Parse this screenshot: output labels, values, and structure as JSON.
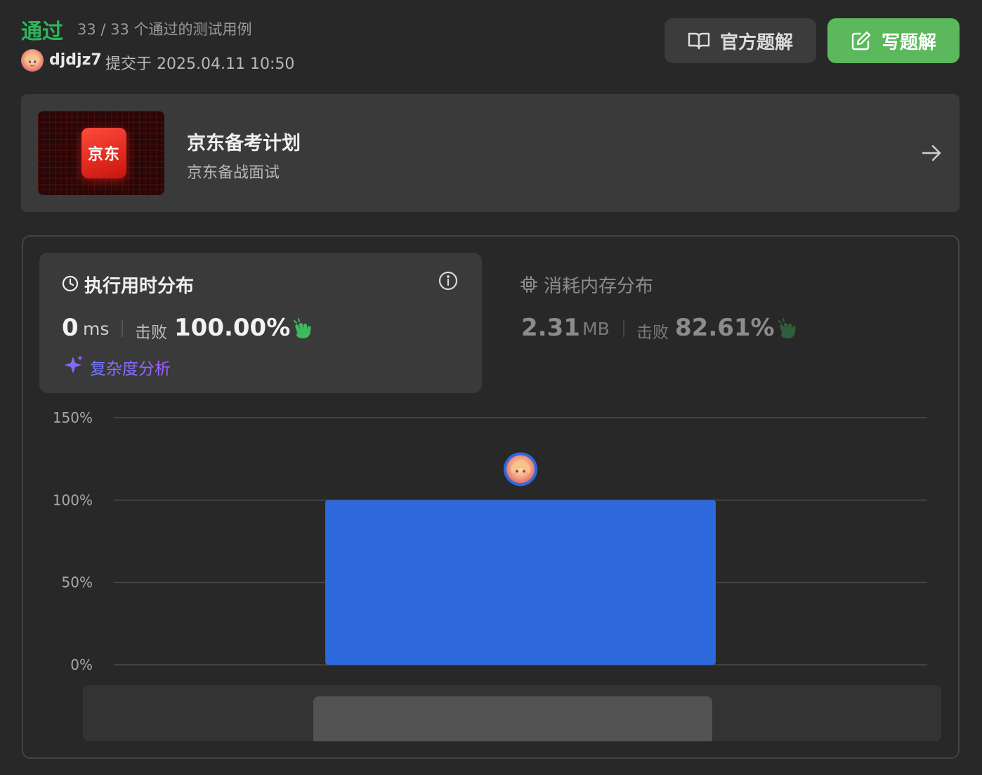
{
  "header": {
    "status": "通过",
    "cases": "33 / 33 个通过的测试用例",
    "username": "djdjz7",
    "submitted": "提交于 2025.04.11 10:50"
  },
  "buttons": {
    "official_solution": "官方题解",
    "write_solution": "写题解"
  },
  "promo": {
    "logo_text": "京东",
    "title": "京东备考计划",
    "subtitle": "京东备战面试"
  },
  "runtime": {
    "title": "执行用时分布",
    "value": "0",
    "unit": "ms",
    "beat_label": "击败",
    "beat_value": "100.00%",
    "complexity_link": "复杂度分析"
  },
  "memory": {
    "title": "消耗内存分布",
    "value": "2.31",
    "unit": "MB",
    "beat_label": "击败",
    "beat_value": "82.61%"
  },
  "colors": {
    "accent_green": "#2db55d",
    "button_green": "#5cb85c",
    "bar_blue": "#2e6ade"
  },
  "icons": {
    "official_solution": "book-icon",
    "write_solution": "edit-icon",
    "promo": "arrow-right-icon",
    "runtime": "clock-icon",
    "info": "info-icon",
    "memory": "chip-icon",
    "complexity": "sparkle-icon",
    "beat": "clap-icon"
  },
  "chart_data": {
    "type": "bar",
    "title": "",
    "xlabel": "",
    "ylabel": "",
    "ylim": [
      0,
      150
    ],
    "yticks": [
      "0%",
      "50%",
      "100%",
      "150%"
    ],
    "xlim": [
      0,
      100
    ],
    "bars": [
      {
        "x_start": 26,
        "x_end": 74,
        "value": 100,
        "highlighted": true
      }
    ],
    "marker": {
      "label": "user-avatar",
      "x": 50
    }
  }
}
